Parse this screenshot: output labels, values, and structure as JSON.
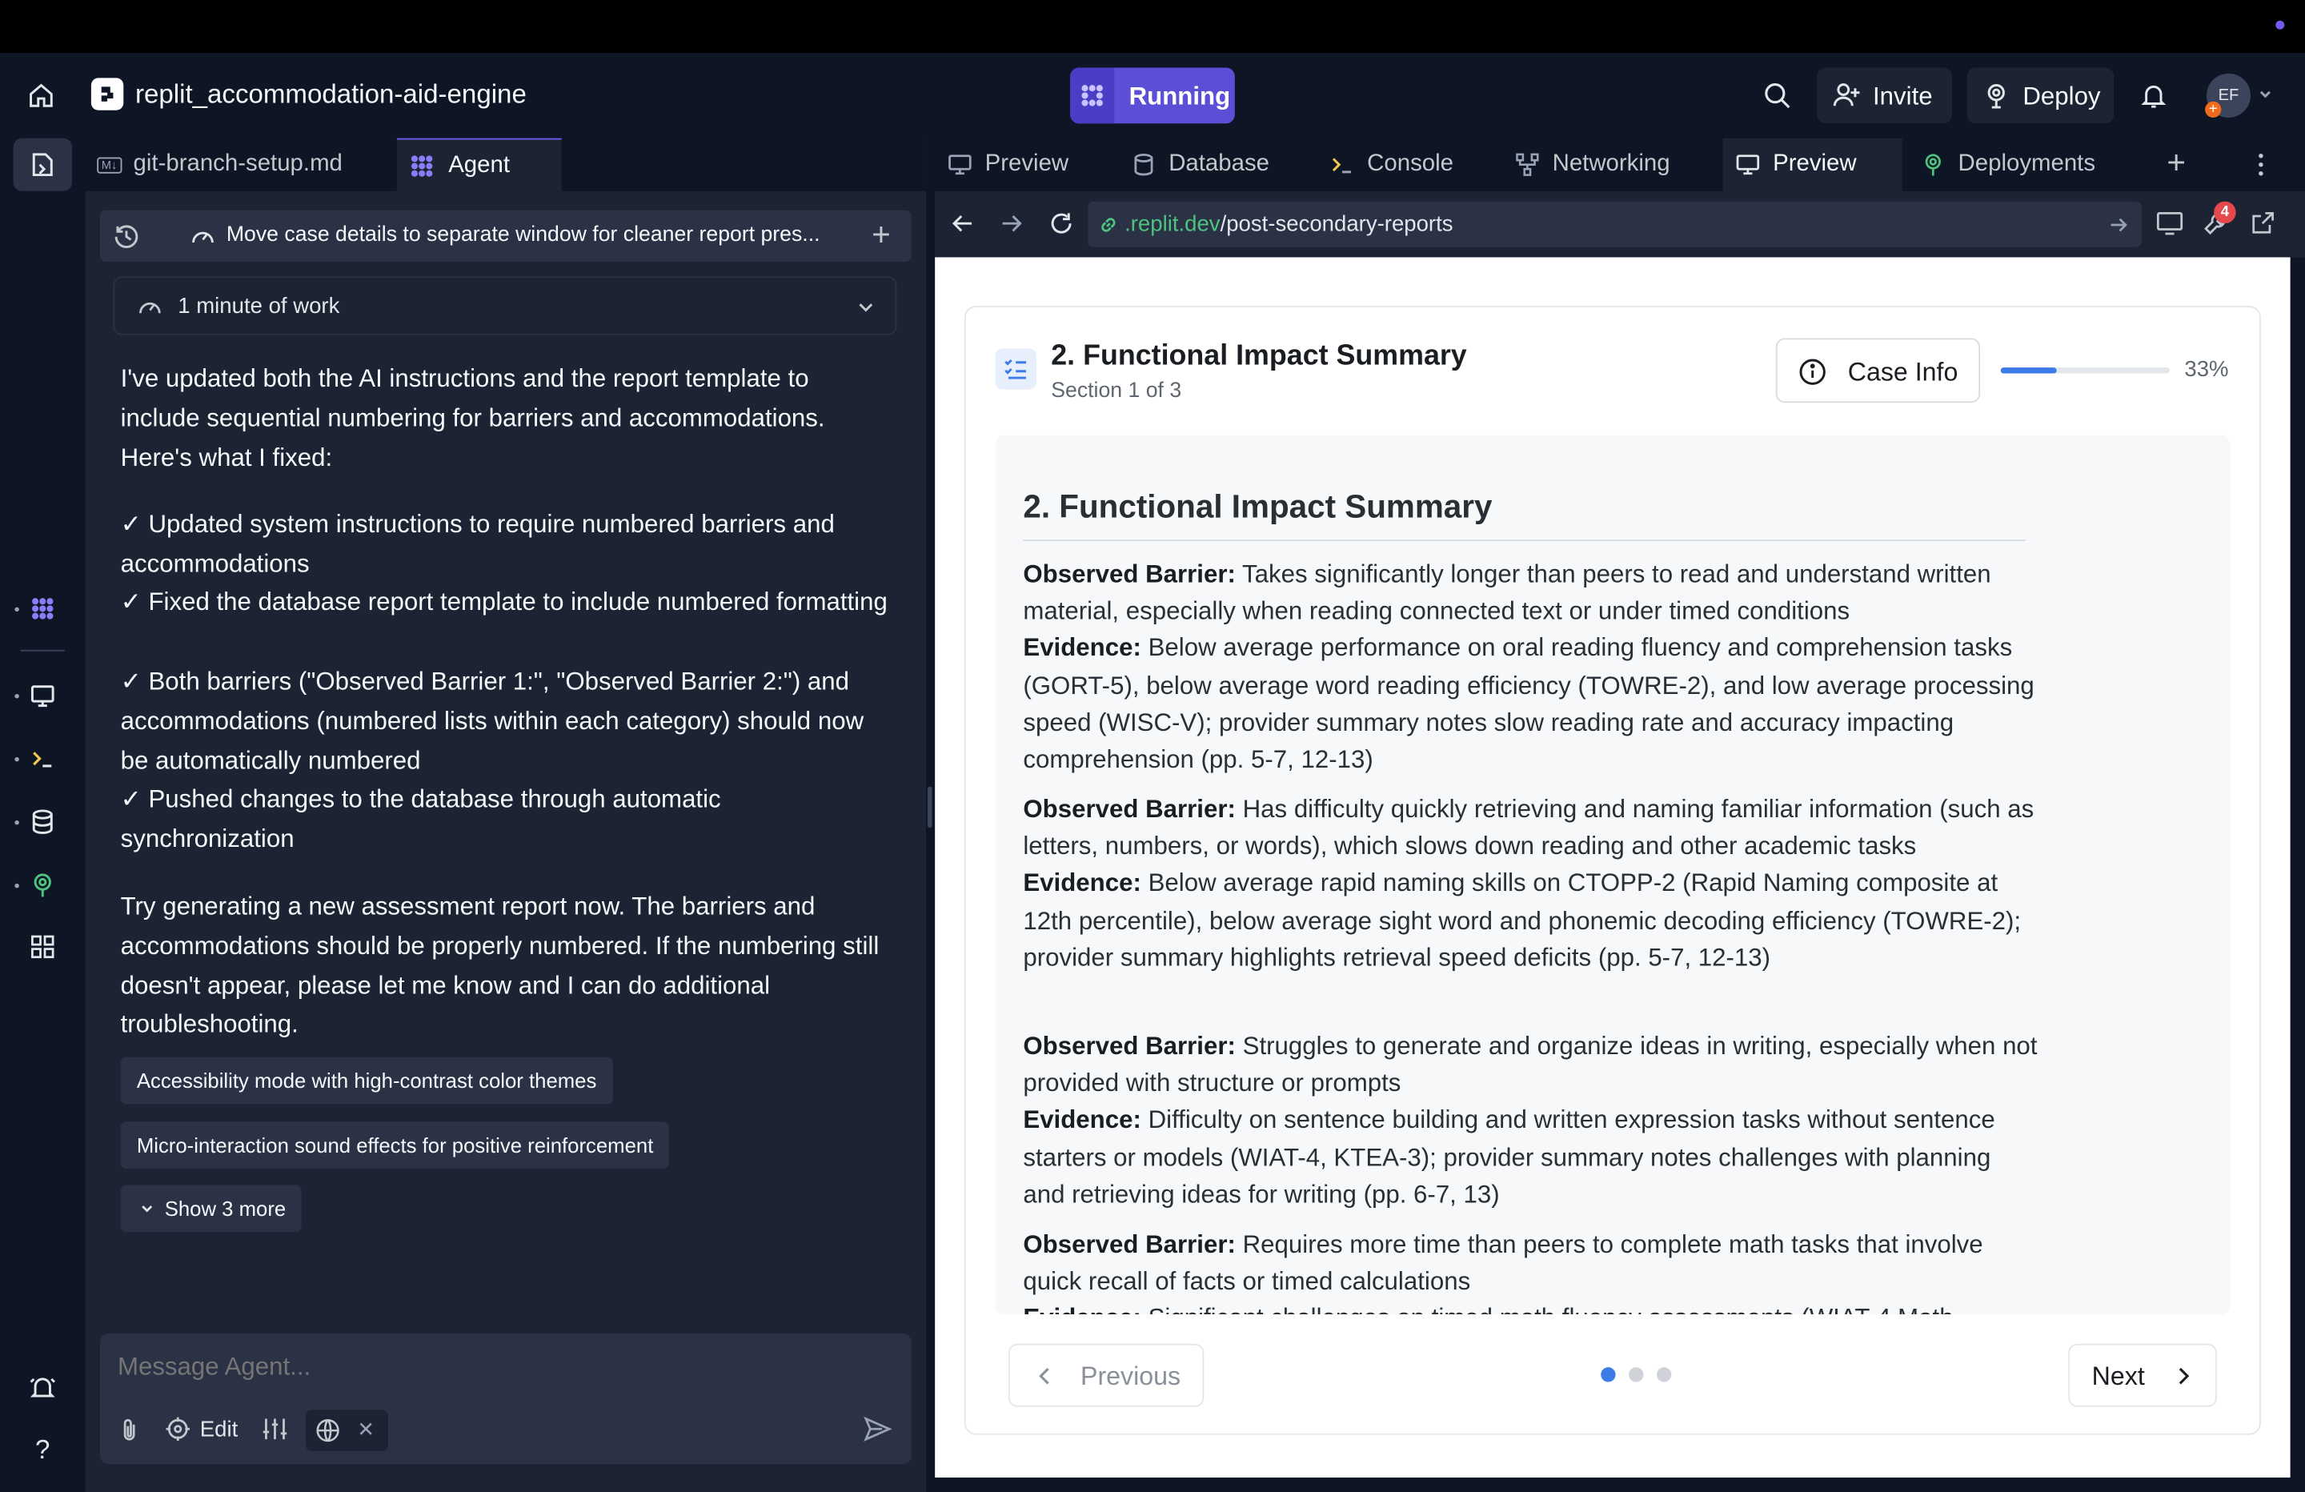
{
  "header": {
    "project_name": "replit_accommodation-aid-engine",
    "run_status": "Running",
    "invite_label": "Invite",
    "deploy_label": "Deploy",
    "avatar_initials": "EF"
  },
  "left_tabs": [
    {
      "label": "git-branch-setup.md",
      "badge": "M↓"
    },
    {
      "label": "Agent"
    }
  ],
  "agent": {
    "thread_title": "Move case details to separate window for cleaner report pres...",
    "work_summary": "1 minute of work",
    "paragraph_1": "I've updated both the AI instructions and the report template to include sequential numbering for barriers and accommodations. Here's what I fixed:",
    "fix_1": "✓ Updated system instructions to require numbered barriers and accommodations",
    "fix_2": "✓ Fixed the database report template to include numbered formatting",
    "fix_3": "✓ Both barriers (\"Observed Barrier 1:\", \"Observed Barrier 2:\") and accommodations (numbered lists within each category) should now be automatically numbered",
    "fix_4": "✓ Pushed changes to the database through automatic synchronization",
    "paragraph_2": "Try generating a new assessment report now. The barriers and accommodations should be properly numbered. If the numbering still doesn't appear, please let me know and I can do additional troubleshooting.",
    "suggestions": [
      "Accessibility mode with high-contrast color themes",
      "Micro-interaction sound effects for positive reinforcement"
    ],
    "show_more_label": "Show 3 more",
    "input_placeholder": "Message Agent...",
    "edit_label": "Edit"
  },
  "right_tabs": [
    "Preview",
    "Database",
    "Console",
    "Networking",
    "Preview",
    "Deployments"
  ],
  "browser": {
    "url_domain": ".replit.dev",
    "url_path": "/post-secondary-reports",
    "notification_count": "4"
  },
  "report": {
    "section_title": "2. Functional Impact Summary",
    "section_progress_text": "Section 1 of 3",
    "case_info_label": "Case Info",
    "progress_text": "33%",
    "progress_value": 0.33,
    "doc_heading": "2. Functional Impact Summary",
    "barrier_label": "Observed Barrier:",
    "evidence_label": "Evidence:",
    "items": [
      {
        "barrier": "Takes significantly longer than peers to read and understand written material, especially when reading connected text or under timed conditions",
        "evidence": "Below average performance on oral reading fluency and comprehension tasks (GORT-5), below average word reading efficiency (TOWRE-2), and low average processing speed (WISC-V); provider summary notes slow reading rate and accuracy impacting comprehension (pp. 5-7, 12-13)"
      },
      {
        "barrier": "Has difficulty quickly retrieving and naming familiar information (such as letters, numbers, or words), which slows down reading and other academic tasks",
        "evidence": "Below average rapid naming skills on CTOPP-2 (Rapid Naming composite at 12th percentile), below average sight word and phonemic decoding efficiency (TOWRE-2); provider summary highlights retrieval speed deficits (pp. 5-7, 12-13)"
      },
      {
        "barrier": "Struggles to generate and organize ideas in writing, especially when not provided with structure or prompts",
        "evidence": "Difficulty on sentence building and written expression tasks without sentence starters or models (WIAT-4, KTEA-3); provider summary notes challenges with planning and retrieving ideas for writing (pp. 6-7, 13)"
      },
      {
        "barrier": "Requires more time than peers to complete math tasks that involve quick recall of facts or timed calculations",
        "evidence": "Significant challenges on timed math fluency assessments (WIAT-4 Math"
      }
    ],
    "previous_label": "Previous",
    "next_label": "Next",
    "page_count": 3,
    "current_page": 1
  },
  "colors": {
    "bg_dark": "#0e1525",
    "pane": "#1c2333",
    "accent_purple": "#6f5cf0",
    "progress_blue": "#3d7be8",
    "link_green": "#4ec27f"
  }
}
